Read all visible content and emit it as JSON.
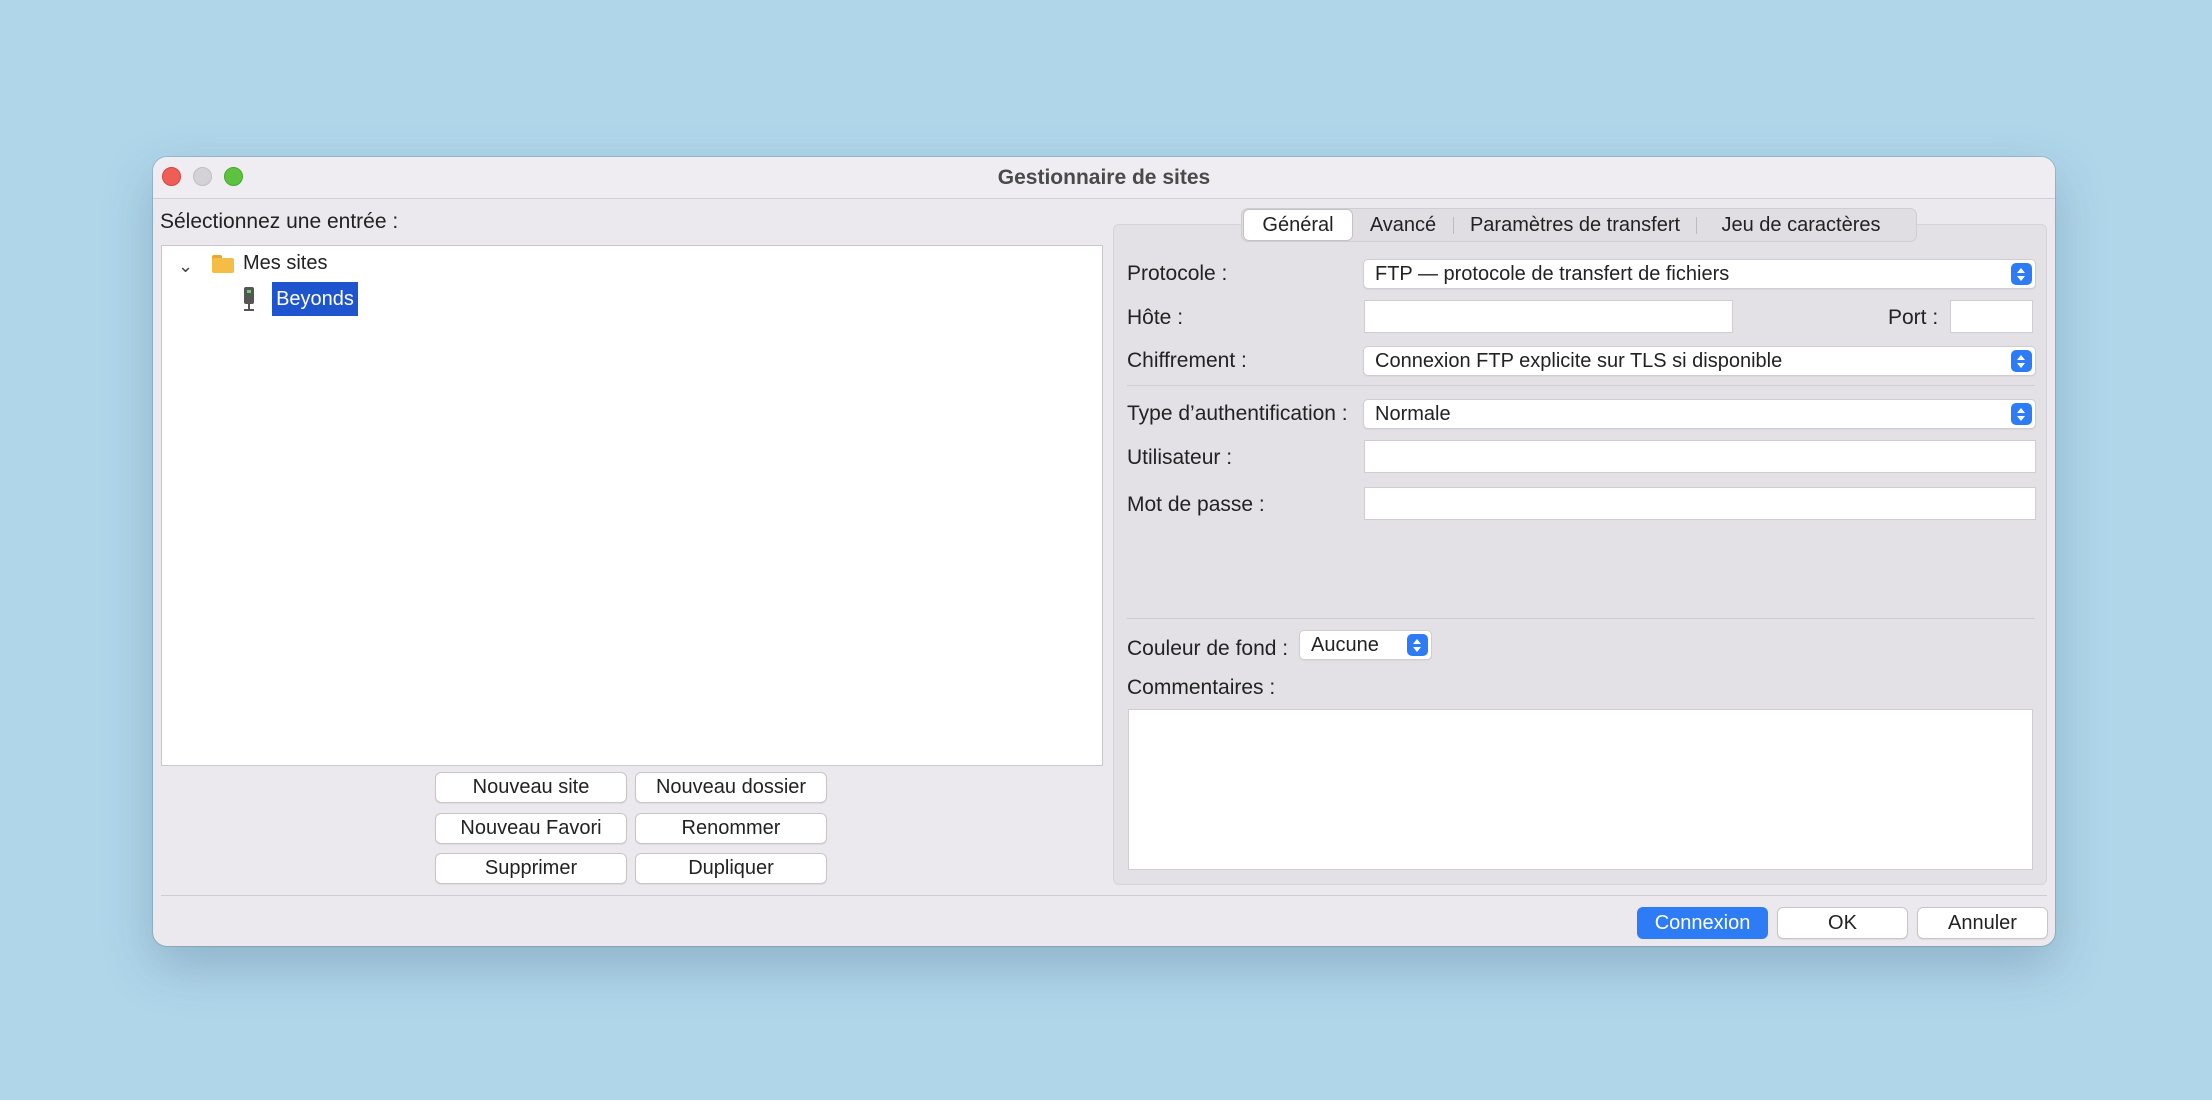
{
  "window": {
    "title": "Gestionnaire de sites"
  },
  "left": {
    "select_label": "Sélectionnez une entrée :",
    "tree": {
      "folder_label": "Mes sites",
      "site_label": "Beyonds"
    },
    "buttons": {
      "new_site": "Nouveau site",
      "new_folder": "Nouveau dossier",
      "new_bookmark": "Nouveau Favori",
      "rename": "Renommer",
      "delete": "Supprimer",
      "duplicate": "Dupliquer"
    }
  },
  "tabs": [
    "Général",
    "Avancé",
    "Paramètres de transfert",
    "Jeu de caractères"
  ],
  "form": {
    "protocol_label": "Protocole :",
    "protocol_value": "FTP — protocole de transfert de fichiers",
    "host_label": "Hôte :",
    "host_value": "",
    "port_label": "Port :",
    "port_value": "",
    "encryption_label": "Chiffrement :",
    "encryption_value": "Connexion FTP explicite sur TLS si disponible",
    "auth_type_label": "Type d’authentification :",
    "auth_type_value": "Normale",
    "user_label": "Utilisateur :",
    "user_value": "",
    "password_label": "Mot de passe :",
    "password_value": "",
    "bg_color_label": "Couleur de fond :",
    "bg_color_value": "Aucune",
    "comments_label": "Commentaires :",
    "comments_value": ""
  },
  "footer": {
    "connect": "Connexion",
    "ok": "OK",
    "cancel": "Annuler"
  },
  "colors": {
    "desktop": "#b0d6ea",
    "accent": "#2d7cf6",
    "selection": "#1f54cf"
  }
}
